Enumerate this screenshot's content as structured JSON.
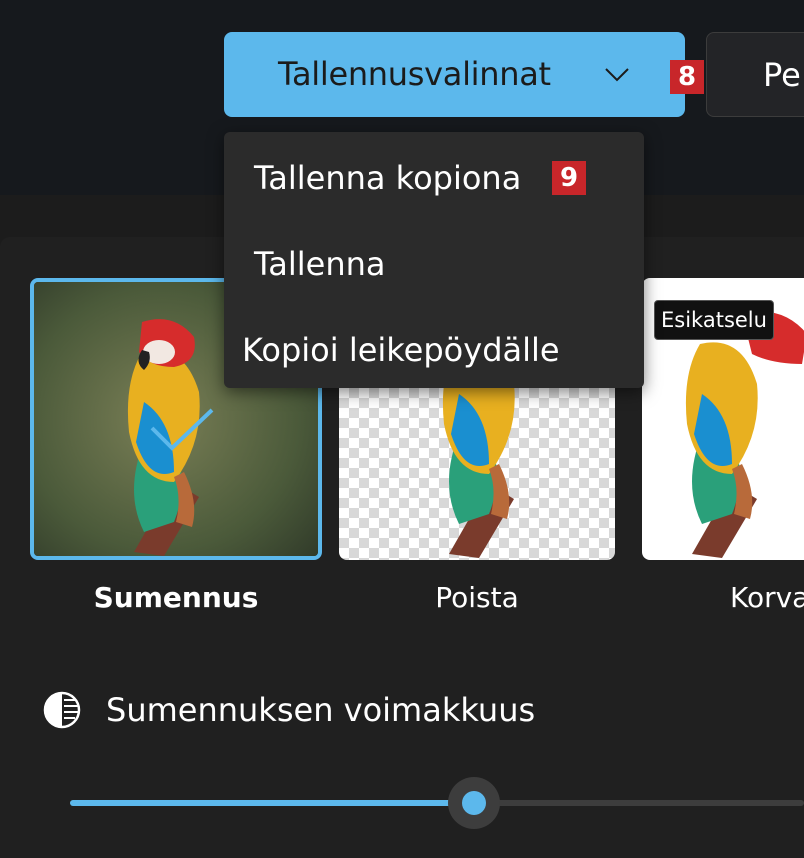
{
  "toolbar": {
    "save_options_label": "Tallennusvalinnat",
    "next_button_label": "Pe",
    "badge_save": "8",
    "badge_menu": "9"
  },
  "save_menu": {
    "items": [
      {
        "label": "Tallenna kopiona"
      },
      {
        "label": "Tallenna"
      },
      {
        "label": "Kopioi leikepöydälle"
      }
    ]
  },
  "background_options": {
    "options": [
      {
        "label": "Sumennus",
        "selected": true
      },
      {
        "label": "Poista",
        "selected": false
      },
      {
        "label": "Korva",
        "selected": false
      }
    ],
    "preview_tooltip": "Esikatselu"
  },
  "blur_strength": {
    "label": "Sumennuksen voimakkuus",
    "value_fraction": 0.55
  },
  "colors": {
    "accent": "#5cb8ec",
    "badge": "#c8262a",
    "panel": "#202020"
  }
}
